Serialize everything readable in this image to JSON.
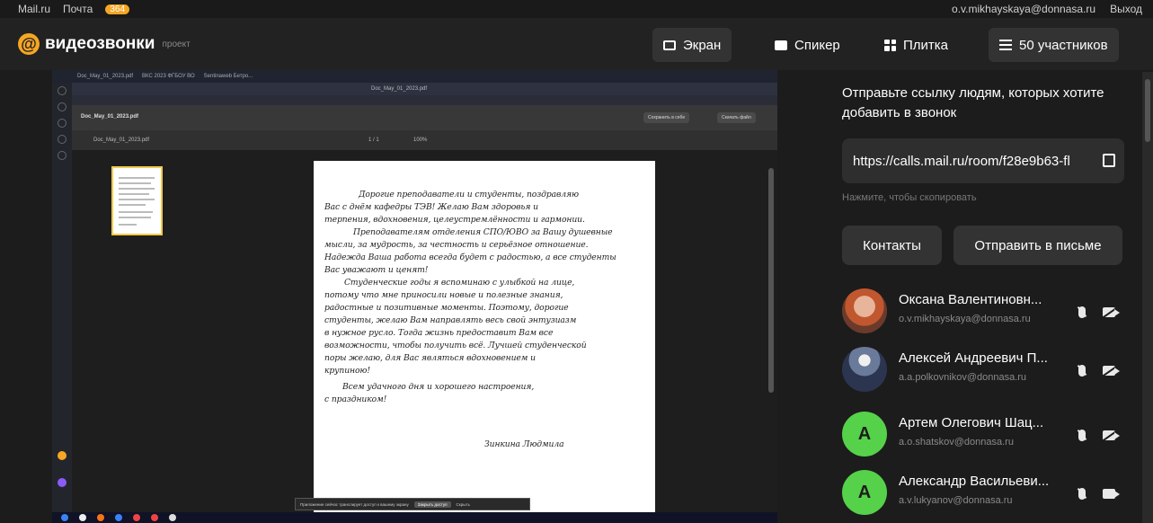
{
  "topbar": {
    "mail_link": "Mail.ru",
    "pochta": "Почта",
    "pochta_count": "364",
    "account": "o.v.mikhayskaya@donnasa.ru",
    "logout": "Выход"
  },
  "app": {
    "name": "видеозвонки",
    "badge": "проект"
  },
  "header_buttons": {
    "screen": "Экран",
    "speaker": "Спикер",
    "tile": "Плитка",
    "participants": "50 участников"
  },
  "shared_screen": {
    "browser_tabs": [
      "Doc_May_01_2023.pdf",
      "ВКС 2023 ФГБОУ ВО",
      "Sentinaweb Бетро..."
    ],
    "address": "Doc_May_01_2023.pdf",
    "doc_name": "Doc_May_01_2023.pdf",
    "zoom": "100%",
    "page_counter": "1 / 1",
    "save_button": "Сохранить в себе",
    "open_button": "Скачать файл",
    "letter": [
      "Дорогие преподаватели и студенты, поздравляю",
      "Вас с днём кафедры ТЭВ! Желаю Вам здоровья и",
      "терпения, вдохновения, целеустремлённости и гармонии.",
      "Преподавателям отделения СПО/ЮВО за Вашу душевные",
      "мысли, за мудрость, за честность и серьёзное отношение.",
      "Надежда Ваша работа всегда будет с радостью, а все студенты",
      "Вас уважают и ценят!",
      "Студенческие годы я вспоминаю с улыбкой на лице,",
      "потому что мне приносили новые и полезные знания,",
      "радостные и позитивные моменты. Поэтому, дорогие",
      "студенты, желаю Вам направлять весь свой энтузиазм",
      "в нужное русло. Тогда жизнь предоставит Вам все",
      "возможности, чтобы получить всё. Лучшей студенческой",
      "поры желаю, для Вас являться вдохновением и",
      "крупиною!",
      "Всем удачного дня и хорошего настроения,",
      "с праздником!"
    ],
    "signature": "Зинкина Людмила",
    "notice_text": "Приложение сейчас транслирует доступ к вашему экрану",
    "notice_stop": "Закрыть доступ",
    "notice_hide": "Скрыть"
  },
  "panel": {
    "invite_text": "Отправьте ссылку людям, которых хотите добавить в звонок",
    "link": "https://calls.mail.ru/room/f28e9b63-fl",
    "copy_hint": "Нажмите, чтобы скопировать",
    "contacts_button": "Контакты",
    "send_mail_button": "Отправить в письме",
    "participants": [
      {
        "name": "Оксана Валентиновн...",
        "email": "o.v.mikhayskaya@donnasa.ru",
        "avatar": "photo",
        "camera": "off"
      },
      {
        "name": "Алексей Андреевич П...",
        "email": "a.a.polkovnikov@donnasa.ru",
        "avatar": "photo",
        "camera": "off"
      },
      {
        "name": "Артем Олегович Шац...",
        "email": "a.o.shatskov@donnasa.ru",
        "avatar": "A",
        "camera": "off"
      },
      {
        "name": "Александр Васильеви...",
        "email": "a.v.lukyanov@donnasa.ru",
        "avatar": "A",
        "camera": "on"
      }
    ]
  },
  "colors": {
    "accent": "#f5a623",
    "avatar_green": "#56d14a",
    "panel_bg": "#1c1c1c",
    "button_bg": "#333333"
  }
}
